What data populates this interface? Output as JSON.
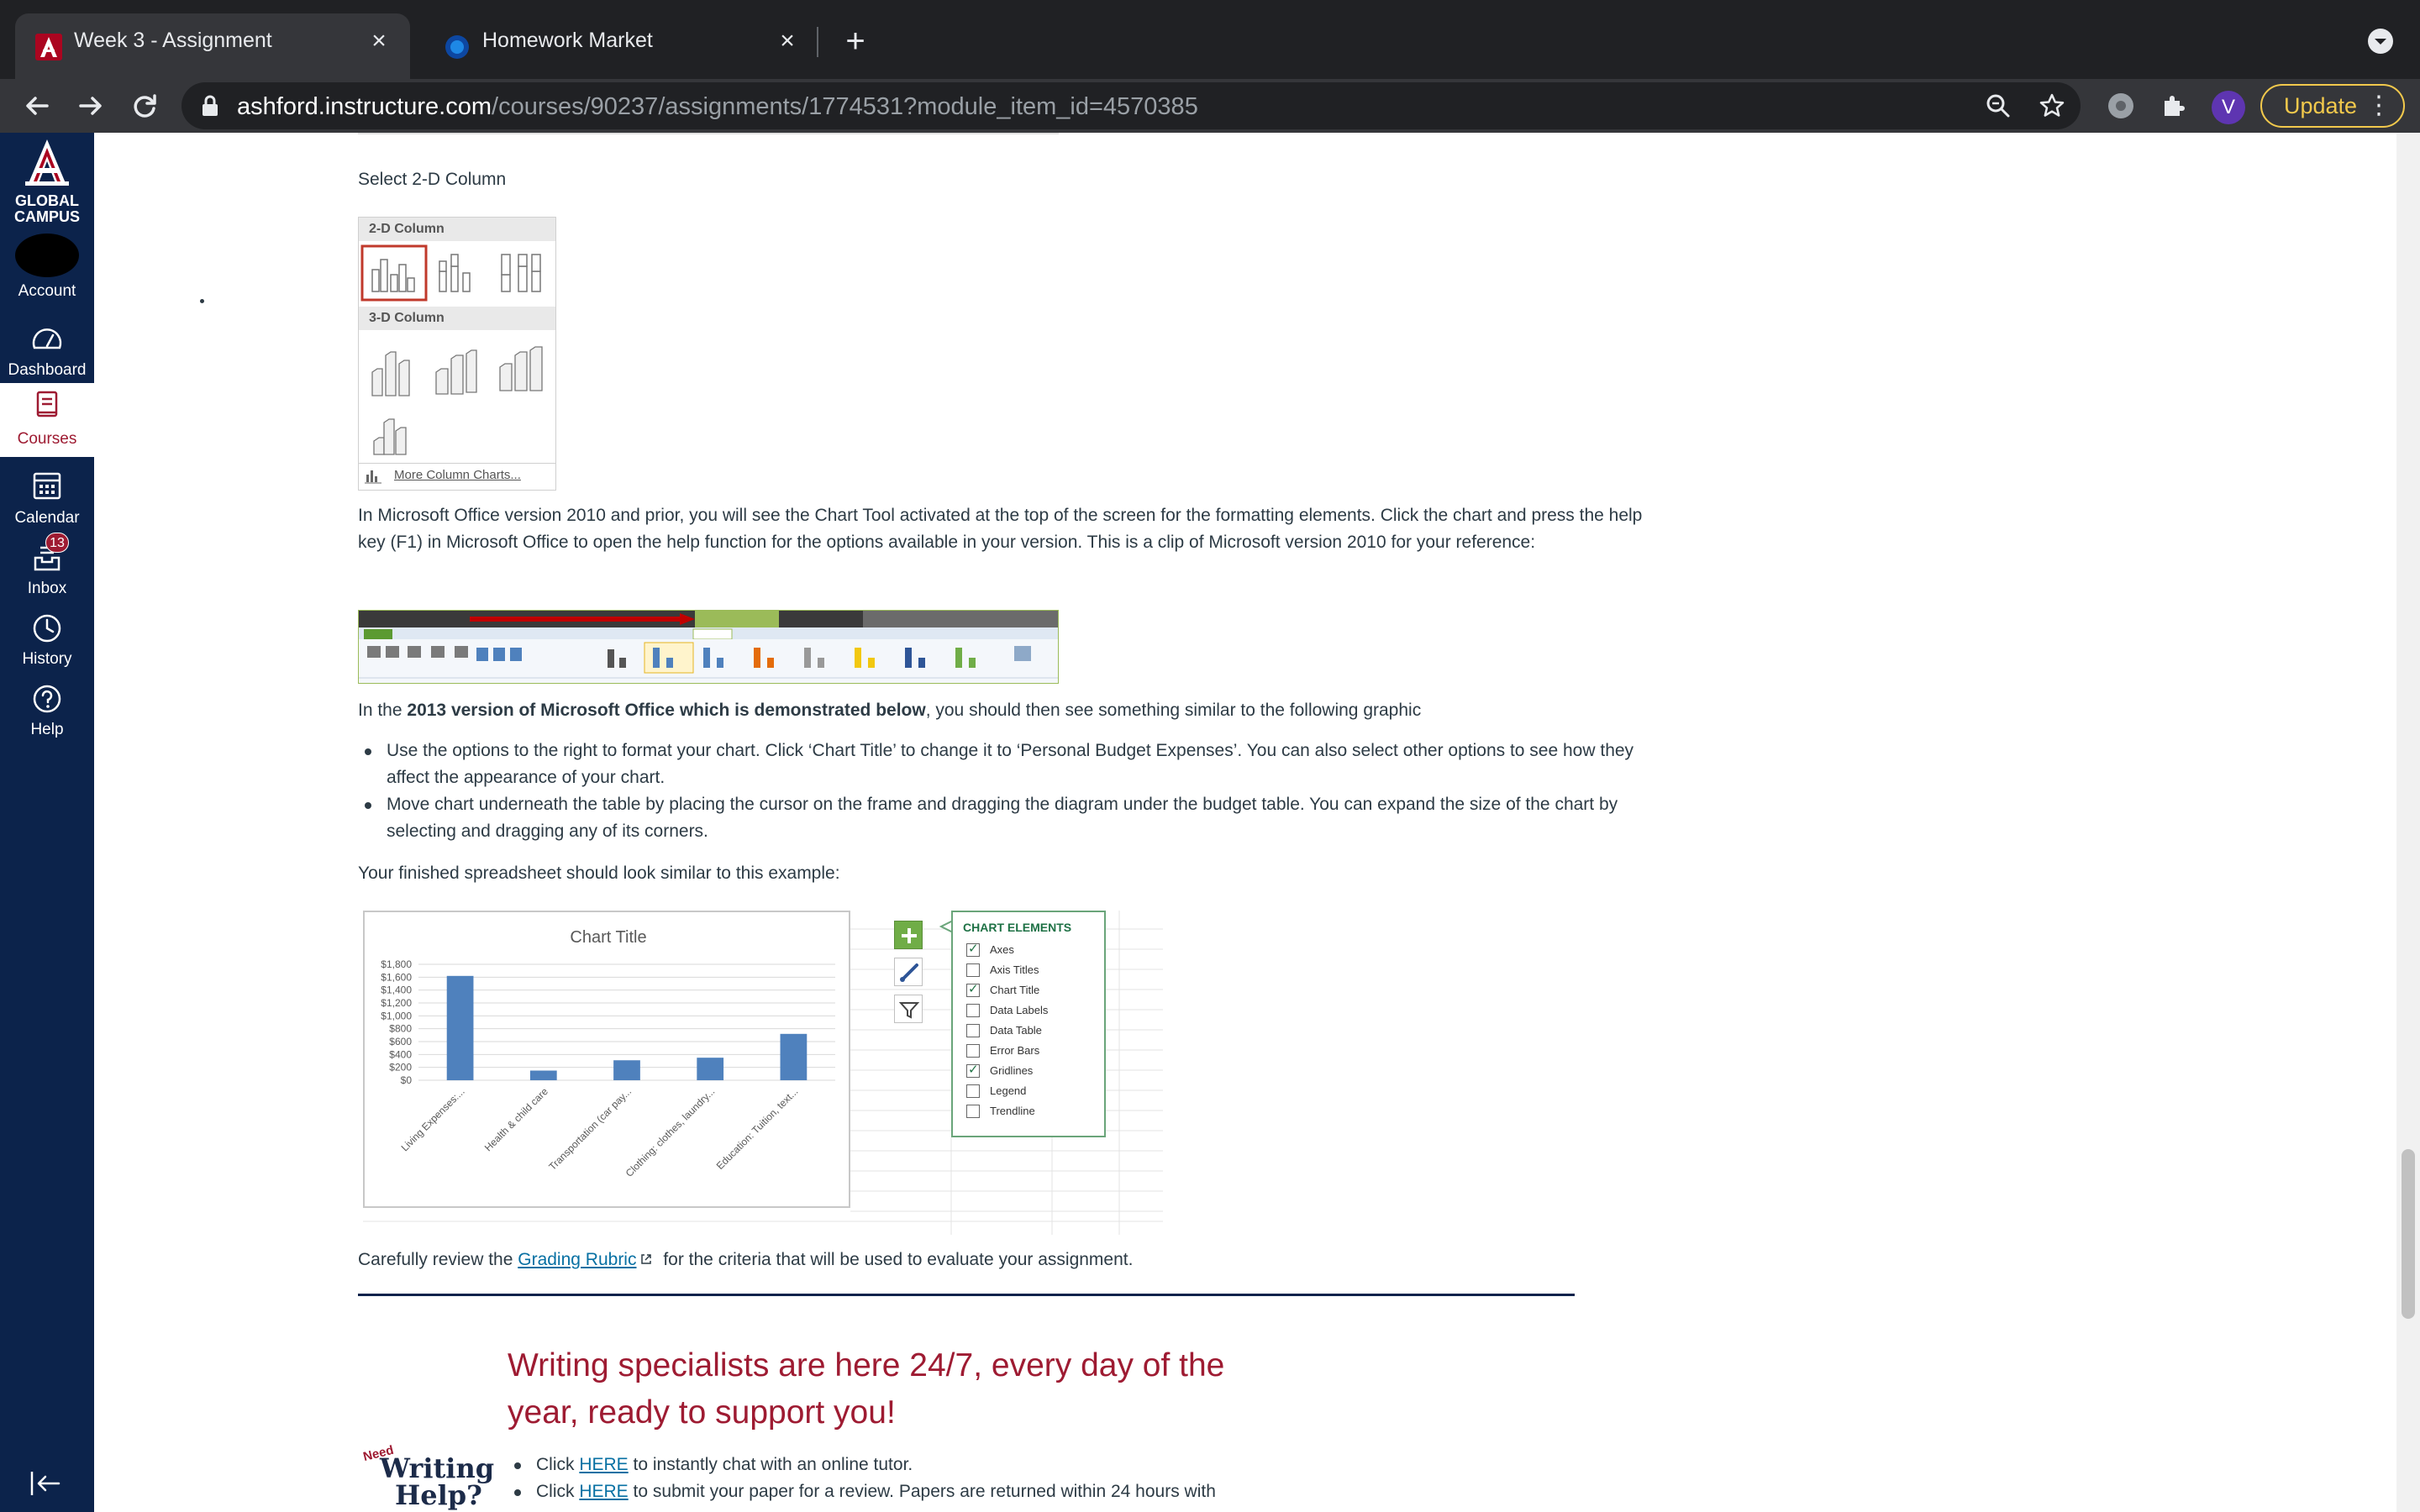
{
  "browser": {
    "tabs": [
      {
        "title": "Week 3 - Assignment",
        "active": true
      },
      {
        "title": "Homework Market",
        "active": false
      }
    ],
    "close_glyph": "×",
    "new_tab_glyph": "+",
    "url_host": "ashford.instructure.com",
    "url_path": "/courses/90237/assignments/1774531?module_item_id=4570385",
    "profile_initial": "V",
    "update_label": "Update"
  },
  "nav": {
    "brand_line1": "GLOBAL",
    "brand_line2": "CAMPUS",
    "items": [
      {
        "label": "Account"
      },
      {
        "label": "Dashboard"
      },
      {
        "label": "Courses"
      },
      {
        "label": "Calendar"
      },
      {
        "label": "Inbox",
        "badge": "13"
      },
      {
        "label": "History"
      },
      {
        "label": "Help"
      }
    ],
    "active_color": "#9e1b32",
    "bg_color": "#0c234b"
  },
  "content": {
    "select_column_text": "Select 2-D Column",
    "picker": {
      "header_2d": "2-D Column",
      "header_3d": "3-D Column",
      "more_label": "More Column Charts..."
    },
    "office2010_paragraph": "In Microsoft Office version 2010 and prior, you will see the Chart Tool activated at the top of the screen for the formatting elements. Click the chart and press the help key (F1) in Microsoft Office to open  the help function for the options available in your version. This is a clip of Microsoft version 2010 for your reference:",
    "office2013_prefix": "In the ",
    "office2013_bold": "2013 version of Microsoft Office which is demonstrated below",
    "office2013_suffix": ", you should then see something similar to the following graphic",
    "bullets": [
      "Use the options to the right to format your chart. Click ‘Chart Title’ to change it to ‘Personal Budget Expenses’. You can also select other options to see how they affect the appearance of your chart.",
      "Move chart underneath the table by placing the cursor on the frame and dragging the diagram under the budget table. You can expand the size of the chart by selecting and dragging any of its corners."
    ],
    "finished_text": "Your finished spreadsheet should look similar to this example:",
    "rubric_prefix": "Carefully review the ",
    "rubric_link": "Grading Rubric",
    "rubric_suffix": " for the criteria that will be used to evaluate your assignment.",
    "writing_heading_line1": "Writing specialists are here 24/7, every day of the",
    "writing_heading_line2": "year, ready to support you!",
    "writing_logo_need": "Need",
    "writing_logo_writing": "Writing",
    "writing_logo_help": "Help?",
    "writing_items": [
      {
        "prefix": "Click ",
        "link": "HERE",
        "suffix": " to instantly chat with an online tutor."
      },
      {
        "prefix": "Click ",
        "link": "HERE",
        "suffix": " to submit your paper for a review. Papers are returned within 24 hours with"
      }
    ]
  },
  "chart_elements": {
    "title": "CHART ELEMENTS",
    "items": [
      {
        "label": "Axes",
        "checked": true
      },
      {
        "label": "Axis Titles",
        "checked": false
      },
      {
        "label": "Chart Title",
        "checked": true
      },
      {
        "label": "Data Labels",
        "checked": false
      },
      {
        "label": "Data Table",
        "checked": false
      },
      {
        "label": "Error Bars",
        "checked": false
      },
      {
        "label": "Gridlines",
        "checked": true
      },
      {
        "label": "Legend",
        "checked": false
      },
      {
        "label": "Trendline",
        "checked": false
      }
    ]
  },
  "chart_data": {
    "type": "bar",
    "title": "Chart Title",
    "categories": [
      "Living Expenses:...",
      "Health & child care",
      "Transportation (car pay...",
      "Clothing: clothes, laundry...",
      "Education: Tuition, text..."
    ],
    "values": [
      1620,
      150,
      310,
      350,
      720
    ],
    "ylim": [
      0,
      1800
    ],
    "yticks": [
      "$0",
      "$200",
      "$400",
      "$600",
      "$800",
      "$1,000",
      "$1,200",
      "$1,400",
      "$1,600",
      "$1,800"
    ],
    "bar_color": "#4f81bd",
    "grid": true
  }
}
